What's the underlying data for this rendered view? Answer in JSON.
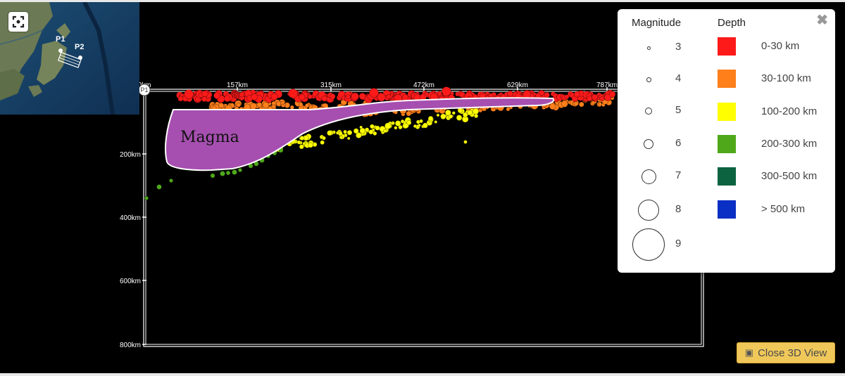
{
  "map_controls": {
    "fullscreen_icon": "fullscreen-icon",
    "profile_start": "P1",
    "profile_end": "P2"
  },
  "section": {
    "distance_ticks": [
      "0km",
      "157km",
      "315km",
      "472km",
      "629km",
      "787km"
    ],
    "depth_ticks": [
      "200km",
      "400km",
      "600km",
      "800km"
    ],
    "start_marker": "P1",
    "annotation": "Magma"
  },
  "legend": {
    "magnitude_title": "Magnitude",
    "depth_title": "Depth",
    "close_icon": "close-icon",
    "magnitudes": [
      "3",
      "4",
      "5",
      "6",
      "7",
      "8",
      "9"
    ],
    "depths": [
      {
        "label": "0-30 km",
        "color": "#ff1a1a"
      },
      {
        "label": "30-100 km",
        "color": "#ff7f1a"
      },
      {
        "label": "100-200 km",
        "color": "#ffff00"
      },
      {
        "label": "200-300 km",
        "color": "#4fa81a"
      },
      {
        "label": "300-500 km",
        "color": "#0c6340"
      },
      {
        "label": "> 500 km",
        "color": "#0a2fc4"
      }
    ]
  },
  "close_3d_button": {
    "label": "Close 3D View",
    "icon": "cube-icon"
  },
  "colors": {
    "background": "#000000",
    "magma": "#a64fb0",
    "button": "#f0c85a"
  }
}
